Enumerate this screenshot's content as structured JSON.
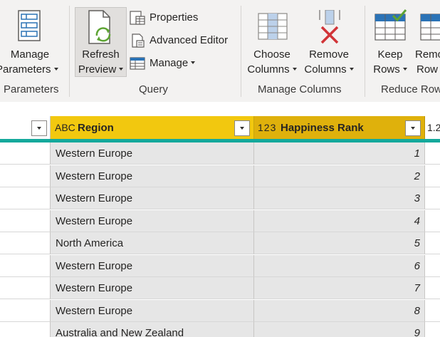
{
  "ribbon": {
    "parameters_group": {
      "manage_parameters": {
        "line1": "Manage",
        "line2": "Parameters"
      },
      "label": "Parameters"
    },
    "query_group": {
      "refresh_preview": {
        "line1": "Refresh",
        "line2": "Preview"
      },
      "properties": "Properties",
      "advanced_editor": "Advanced Editor",
      "manage": "Manage",
      "label": "Query"
    },
    "manage_columns_group": {
      "choose_columns": {
        "line1": "Choose",
        "line2": "Columns"
      },
      "remove_columns": {
        "line1": "Remove",
        "line2": "Columns"
      },
      "label": "Manage Columns"
    },
    "reduce_rows_group": {
      "keep_rows": {
        "line1": "Keep",
        "line2": "Rows"
      },
      "remove_rows": {
        "line1": "Remo",
        "line2": "Row"
      },
      "label": "Reduce Row"
    }
  },
  "grid": {
    "columns": [
      {
        "type_icon": "ABC",
        "name": "Region"
      },
      {
        "type_icon": "123",
        "name": "Happiness Rank"
      },
      {
        "type_icon": "1.2",
        "name": ""
      }
    ],
    "rows": [
      {
        "region": "Western Europe",
        "rank": "1"
      },
      {
        "region": "Western Europe",
        "rank": "2"
      },
      {
        "region": "Western Europe",
        "rank": "3"
      },
      {
        "region": "Western Europe",
        "rank": "4"
      },
      {
        "region": "North America",
        "rank": "5"
      },
      {
        "region": "Western Europe",
        "rank": "6"
      },
      {
        "region": "Western Europe",
        "rank": "7"
      },
      {
        "region": "Western Europe",
        "rank": "8"
      },
      {
        "region": "Australia and New Zealand",
        "rank": "9"
      }
    ]
  },
  "colors": {
    "ribbon_bg": "#f3f2f1",
    "region_header": "#f2c80f",
    "rank_header": "#dfb10c",
    "selected_cell": "#e6e6e6",
    "quality_bar": "#14a99c",
    "accent_blue": "#2b73b6",
    "remove_red": "#d13438",
    "keep_green": "#5ea434"
  }
}
